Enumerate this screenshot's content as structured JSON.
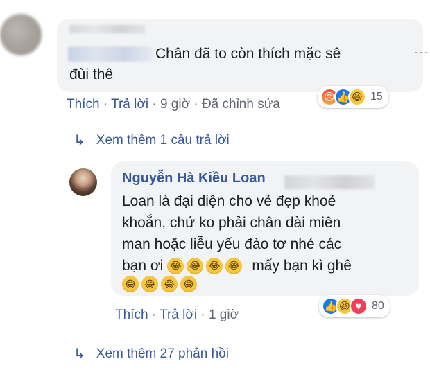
{
  "comment1": {
    "text_line1": "Chân đã to còn thích mặc sê",
    "text_line2": "đùi thê",
    "more_icon": "···",
    "reactions": {
      "icons": [
        "angry-icon",
        "like-icon",
        "haha-icon"
      ],
      "count": "15"
    },
    "meta": {
      "like": "Thích",
      "reply": "Trả lời",
      "time": "9 giờ",
      "edited": "Đã chỉnh sửa",
      "sep": " · "
    }
  },
  "reply_link_1": {
    "arrow": "↳",
    "text": "Xem thêm 1 câu trả lời"
  },
  "comment2": {
    "author": "Nguyễn Hà Kiều Loan",
    "line1": "Loan là đại diện cho vẻ đẹp khoẻ",
    "line2": "khoắn, chứ ko phải chân dài miên",
    "line3": "man hoặc liễu yếu đào tơ nhé các",
    "line4_text": "bạn ơi",
    "line4_tail": "mấy bạn kì ghê",
    "laugh_glyph": "😂",
    "reactions": {
      "icons": [
        "like-icon",
        "haha-icon",
        "love-icon"
      ],
      "count": "80"
    },
    "meta": {
      "like": "Thích",
      "reply": "Trả lời",
      "time": "1 giờ",
      "sep": " · "
    }
  },
  "reply_link_2": {
    "arrow": "↳",
    "text": "Xem thêm 27 phản hồi"
  },
  "colors": {
    "link": "#385898",
    "bubble": "#f2f3f5",
    "meta": "#606770",
    "like_blue": "#1877f2",
    "love_red": "#f33e58",
    "haha_yellow": "#f7c73b"
  }
}
